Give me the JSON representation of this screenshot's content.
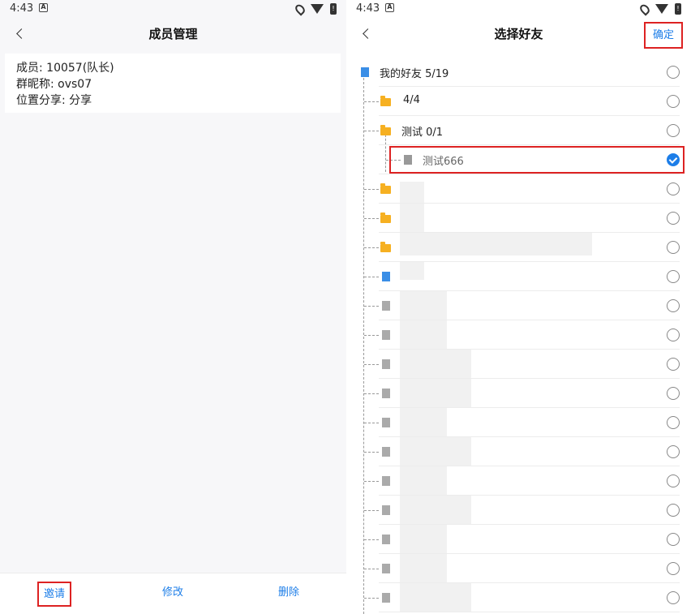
{
  "status_bar": {
    "time": "4:43"
  },
  "left": {
    "title": "成员管理",
    "member_line": "成员: 10057(队长)",
    "nickname_line": "群昵称: ovs07",
    "location_line": "位置分享: 分享",
    "buttons": {
      "invite": "邀请",
      "modify": "修改",
      "delete": "删除"
    }
  },
  "right": {
    "title": "选择好友",
    "confirm": "确定",
    "tree": [
      {
        "label": "我的好友 5/19",
        "checked": false
      },
      {
        "label": "4/4",
        "checked": false
      },
      {
        "label": "测试 0/1",
        "checked": false
      },
      {
        "label": "测试666",
        "checked": true
      }
    ]
  },
  "colors": {
    "accent": "#1d7ee8",
    "highlight_border": "#dd2222",
    "folder": "#f6b021"
  }
}
